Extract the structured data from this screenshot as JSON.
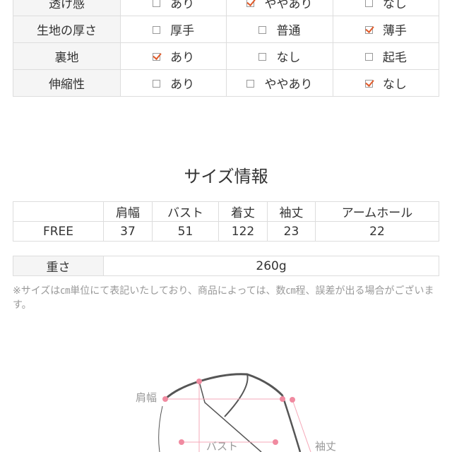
{
  "attributes": [
    {
      "label": "透け感",
      "options": [
        {
          "text": "あり",
          "checked": false
        },
        {
          "text": "ややあり",
          "checked": true
        },
        {
          "text": "なし",
          "checked": false
        }
      ]
    },
    {
      "label": "生地の厚さ",
      "options": [
        {
          "text": "厚手",
          "checked": false
        },
        {
          "text": "普通",
          "checked": false
        },
        {
          "text": "薄手",
          "checked": true
        }
      ]
    },
    {
      "label": "裏地",
      "options": [
        {
          "text": "あり",
          "checked": true
        },
        {
          "text": "なし",
          "checked": false
        },
        {
          "text": "起毛",
          "checked": false
        }
      ]
    },
    {
      "label": "伸縮性",
      "options": [
        {
          "text": "あり",
          "checked": false
        },
        {
          "text": "ややあり",
          "checked": false
        },
        {
          "text": "なし",
          "checked": true
        }
      ]
    }
  ],
  "check_color": "#e05a2a",
  "size_title": "サイズ情報",
  "size_table": {
    "headers": [
      "",
      "肩幅",
      "バスト",
      "着丈",
      "袖丈",
      "アームホール"
    ],
    "rows": [
      [
        "FREE",
        "37",
        "51",
        "122",
        "23",
        "22"
      ]
    ]
  },
  "weight": {
    "label": "重さ",
    "value": "260g"
  },
  "note": "※サイズは㎝単位にて表記いたしており、商品によっては、数㎝程、誤差が出る場合がございます。",
  "diagram": {
    "labels": {
      "shoulder": "肩幅",
      "bust": "バスト",
      "sleeve": "袖丈"
    },
    "marker_color": "#f08aa0"
  }
}
